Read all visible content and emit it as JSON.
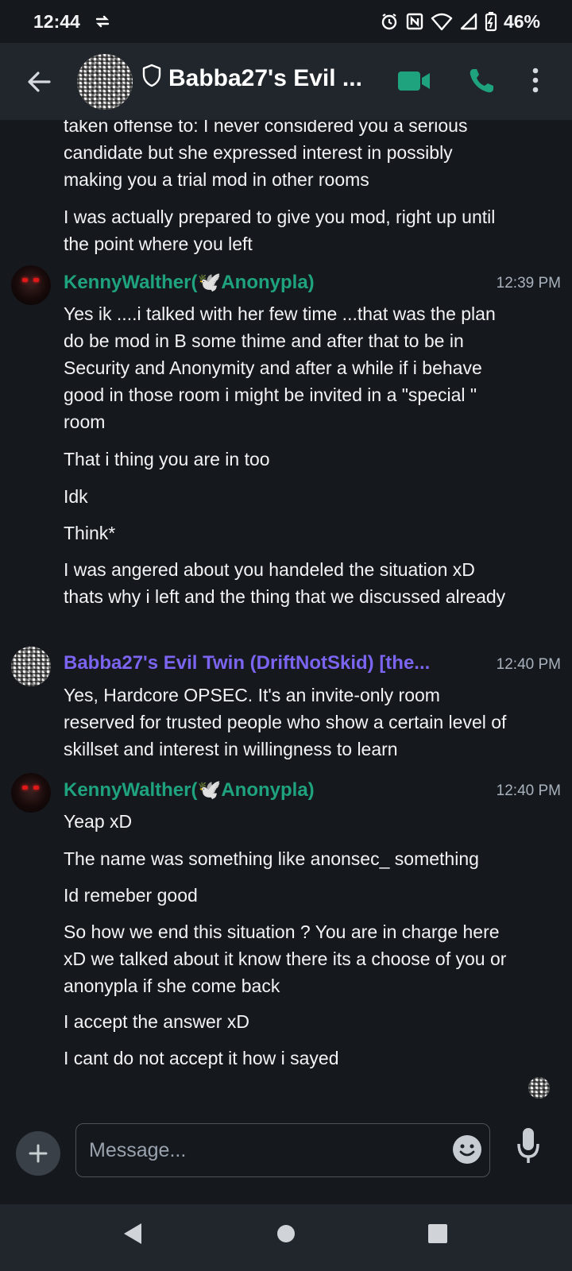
{
  "status_bar": {
    "time": "12:44",
    "battery": "46%",
    "icons": [
      "data-sync-icon",
      "alarm-icon",
      "nfc-icon",
      "wifi-icon",
      "cellular-signal-icon",
      "battery-icon"
    ]
  },
  "header": {
    "room_name": "Babba27's Evil ...",
    "icons": [
      "back-arrow-icon",
      "shield-icon",
      "video-call-icon",
      "phone-call-icon",
      "more-options-icon"
    ],
    "accent_color": "#1fa37f"
  },
  "messages": [
    {
      "sender": "",
      "lines": [
        "taken offense to: I never considered you a serious candidate but she expressed interest in possibly making you a trial mod in other rooms",
        "I was actually prepared to give you mod, right up until the point where you left"
      ]
    },
    {
      "sender": "KennyWalther(🕊️Anonypla)",
      "time": "12:39 PM",
      "color": "#1fa37f",
      "lines": [
        "Yes ik ....i talked with her few time ...that was the plan do be mod in B some thime and after that to be in Security and Anonymity and after a while if i behave good in those room i might be invited in a \"special \" room",
        "That i thing you are in too",
        "Idk",
        "Think*",
        "I was angered about you handeled the situation xD thats why i left and the thing that we discussed already"
      ]
    },
    {
      "sender": "Babba27's Evil Twin (DriftNotSkid) [the...",
      "time": "12:40 PM",
      "color": "#7a64f0",
      "lines": [
        "Yes, Hardcore OPSEC. It's an invite-only room reserved for trusted people who show a certain level of skillset and interest in willingness to learn"
      ]
    },
    {
      "sender": "KennyWalther(🕊️Anonypla)",
      "time": "12:40 PM",
      "color": "#1fa37f",
      "lines": [
        "Yeap xD",
        "The name was something like anonsec_ something",
        "Id remeber good",
        "So how we end this situation ? You are in charge here xD we talked about it know there its a choose of you or anonypla if she come back",
        "I accept the answer xD",
        "I cant do not accept it how i sayed"
      ]
    }
  ],
  "composer": {
    "placeholder": "Message...",
    "icons": [
      "plus-icon",
      "emoji-icon",
      "microphone-icon"
    ]
  },
  "nav_bar": {
    "icons": [
      "nav-back-icon",
      "nav-home-icon",
      "nav-recents-icon"
    ]
  }
}
